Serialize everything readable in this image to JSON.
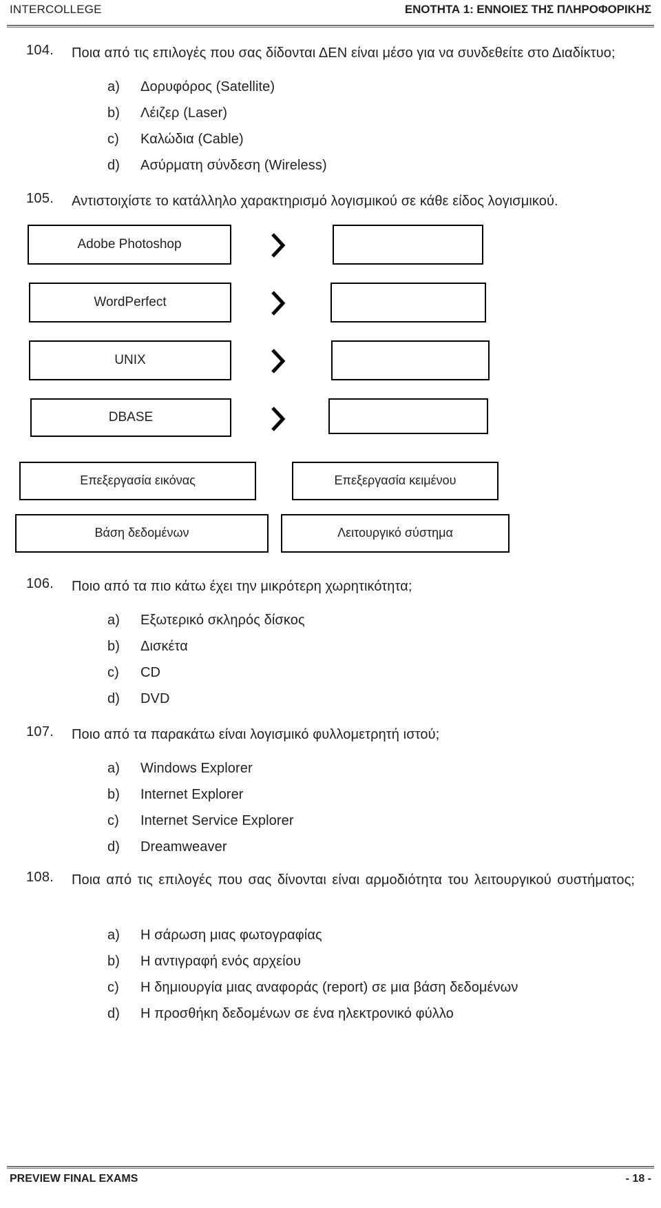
{
  "header": {
    "left": "INTERCOLLEGE",
    "right": "ΕΝΟΤΗΤΑ 1: ΕΝΝΟΙΕΣ ΤΗΣ ΠΛΗΡΟΦΟΡΙΚΗΣ"
  },
  "footer": {
    "left": "PREVIEW FINAL EXAMS",
    "right": "- 18 -"
  },
  "questions": {
    "q104": {
      "number": "104.",
      "text": "Ποια από τις επιλογές που σας δίδονται ΔΕΝ είναι μέσο για να συνδεθείτε στο Διαδίκτυο;",
      "options": [
        {
          "letter": "a)",
          "text": "Δορυφόρος (Satellite)"
        },
        {
          "letter": "b)",
          "text": "Λέιζερ (Laser)"
        },
        {
          "letter": "c)",
          "text": "Καλώδια (Cable)"
        },
        {
          "letter": "d)",
          "text": "Ασύρματη σύνδεση (Wireless)"
        }
      ]
    },
    "q105": {
      "number": "105.",
      "text": "Αντιστοιχίστε το κατάλληλο χαρακτηρισμό λογισμικού σε κάθε είδος λογισμικού.",
      "pairs": [
        {
          "left": "Adobe Photoshop",
          "right": ""
        },
        {
          "left": "WordPerfect",
          "right": ""
        },
        {
          "left": "UNIX",
          "right": ""
        },
        {
          "left": "DBASE",
          "right": ""
        }
      ],
      "bank": [
        "Επεξεργασία εικόνας",
        "Επεξεργασία κειμένου",
        "Βάση δεδομένων",
        "Λειτουργικό σύστημα"
      ],
      "arrow_glyph": "chevron-right"
    },
    "q106": {
      "number": "106.",
      "text": "Ποιο από τα πιο κάτω έχει την μικρότερη χωρητικότητα;",
      "options": [
        {
          "letter": "a)",
          "text": "Εξωτερικό σκληρός δίσκος"
        },
        {
          "letter": "b)",
          "text": "Δισκέτα"
        },
        {
          "letter": "c)",
          "text": "CD"
        },
        {
          "letter": "d)",
          "text": "DVD"
        }
      ]
    },
    "q107": {
      "number": "107.",
      "text": "Ποιο από τα παρακάτω είναι λογισμικό φυλλομετρητή ιστού;",
      "options": [
        {
          "letter": "a)",
          "text": "Windows Explorer"
        },
        {
          "letter": "b)",
          "text": "Internet Explorer"
        },
        {
          "letter": "c)",
          "text": "Internet Service Explorer"
        },
        {
          "letter": "d)",
          "text": "Dreamweaver"
        }
      ]
    },
    "q108": {
      "number": "108.",
      "text": "Ποια από τις επιλογές που σας δίνονται είναι αρμοδιότητα του λειτουργικού συστήματος;",
      "options": [
        {
          "letter": "a)",
          "text": "Η σάρωση μιας φωτογραφίας"
        },
        {
          "letter": "b)",
          "text": "Η αντιγραφή ενός αρχείου"
        },
        {
          "letter": "c)",
          "text": "Η δημιουργία μιας αναφοράς (report) σε μια βάση δεδομένων"
        },
        {
          "letter": "d)",
          "text": "Η προσθήκη δεδομένων σε ένα ηλεκτρονικό φύλλο"
        }
      ]
    }
  }
}
